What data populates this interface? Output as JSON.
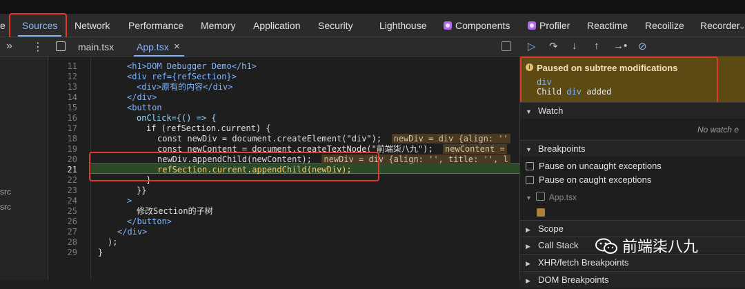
{
  "main_tabs": [
    "e",
    "Sources",
    "Network",
    "Performance",
    "Memory",
    "Application",
    "Security",
    "Lighthouse",
    "Components",
    "Profiler",
    "Reactime",
    "Recoilize",
    "Recorder"
  ],
  "file_tabs": {
    "tab1": "main.tsx",
    "tab2": "App.tsx",
    "close": "×"
  },
  "left_sidebar": {
    "item1": "src",
    "item2": "src"
  },
  "code_lines": [
    {
      "n": "11",
      "text": "<h1>DOM Debugger Demo</h1>"
    },
    {
      "n": "12",
      "text": "<div ref={refSection}>"
    },
    {
      "n": "13",
      "text": "<div>原有的内容</div>"
    },
    {
      "n": "14",
      "text": "</div>"
    },
    {
      "n": "15",
      "text": "<button"
    },
    {
      "n": "16",
      "text": "onClick={() => {"
    },
    {
      "n": "17",
      "text": "if (refSection.current) {"
    },
    {
      "n": "18",
      "text": "const newDiv = document.createElement(\"div\");",
      "value": "newDiv = div {align: ''"
    },
    {
      "n": "19",
      "text": "const newContent = document.createTextNode(\"前端柒八九\");",
      "value": "newContent ="
    },
    {
      "n": "20",
      "text": "newDiv.appendChild(newContent);",
      "value": "newDiv = div {align: '', title: '', l"
    },
    {
      "n": "21",
      "text": "refSection.current.appendChild(newDiv);"
    },
    {
      "n": "22",
      "text": "}"
    },
    {
      "n": "23",
      "text": "}}"
    },
    {
      "n": "24",
      "text": ">"
    },
    {
      "n": "25",
      "text": "修改Section的子树"
    },
    {
      "n": "26",
      "text": "</button>"
    },
    {
      "n": "27",
      "text": "</div>"
    },
    {
      "n": "28",
      "text": ");"
    },
    {
      "n": "29",
      "text": "}"
    }
  ],
  "paused": {
    "title": "Paused on subtree modifications",
    "node": "div",
    "detail_pre": "Child ",
    "detail_node": "div",
    "detail_post": " added"
  },
  "watch": {
    "label": "Watch",
    "empty": "No watch e"
  },
  "breakpoints": {
    "label": "Breakpoints",
    "uncaught": "Pause on uncaught exceptions",
    "caught": "Pause on caught exceptions",
    "file": "App.tsx"
  },
  "sections": {
    "scope": "Scope",
    "call_stack": "Call Stack",
    "xhr": "XHR/fetch Breakpoints",
    "dom": "DOM Breakpoints"
  },
  "watermark": "前端柒八九",
  "colors": {
    "accent": "#8ab4f8",
    "highlight_box": "#e23b2e",
    "paused_bg": "#5c4a12",
    "current_line": "#2c4a27"
  }
}
